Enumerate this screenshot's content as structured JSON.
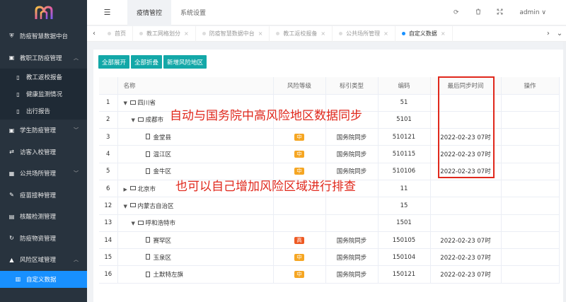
{
  "colors": {
    "sidebar_bg": "#28333e",
    "active": "#1890ff",
    "btn": "#13a8a8",
    "tag_mid": "#f5a623",
    "tag_high": "#ee5a24",
    "annotation": "#e0281c"
  },
  "sidebar": {
    "items": [
      {
        "label": "防疫智慧数据中台",
        "icon": "shield-icon"
      },
      {
        "label": "教职工防疫管理",
        "icon": "briefcase-icon",
        "arrow": "^"
      },
      {
        "label": "教工返校报备",
        "icon": "document-icon",
        "sub": true
      },
      {
        "label": "健康监测情况",
        "icon": "document-icon",
        "sub": true
      },
      {
        "label": "出行报告",
        "icon": "document-icon",
        "sub": true
      },
      {
        "label": "学生防疫管理",
        "icon": "briefcase-icon",
        "arrow": "v"
      },
      {
        "label": "访客入校管理",
        "icon": "swap-icon"
      },
      {
        "label": "公共场所管理",
        "icon": "building-icon",
        "arrow": "v"
      },
      {
        "label": "疫苗接种管理",
        "icon": "syringe-icon"
      },
      {
        "label": "核酸检测管理",
        "icon": "clipboard-icon"
      },
      {
        "label": "防疫物资管理",
        "icon": "refresh-icon"
      },
      {
        "label": "风险区域管理",
        "icon": "warning-icon",
        "arrow": "^"
      },
      {
        "label": "自定义数据",
        "icon": "chart-icon",
        "sub": true,
        "active": true
      }
    ]
  },
  "header": {
    "tabs": [
      "疫情管控",
      "系统设置"
    ],
    "user": "admin",
    "user_arrow": "∨"
  },
  "tabsbar": {
    "tabs": [
      "首页",
      "教工网格划分",
      "防疫智慧数据中台",
      "教工返校报备",
      "公共场所管理",
      "自定义数据"
    ]
  },
  "toolbar": {
    "expand": "全部展开",
    "collapse": "全部折叠",
    "add": "新增风险地区"
  },
  "table": {
    "headers": [
      "",
      "名称",
      "风险等级",
      "标引类型",
      "编码",
      "最后同步时间",
      "操作"
    ],
    "rows": [
      {
        "idx": "1",
        "name": "四川省",
        "level": 0,
        "type": "folder",
        "expanded": true,
        "risk": "",
        "sync": "",
        "code": "51",
        "time": ""
      },
      {
        "idx": "2",
        "name": "成都市",
        "level": 1,
        "type": "folder",
        "expanded": true,
        "risk": "",
        "sync": "",
        "code": "5101",
        "time": ""
      },
      {
        "idx": "3",
        "name": "金堂县",
        "level": 2,
        "type": "file",
        "risk": "中",
        "sync": "国务院同步",
        "code": "510121",
        "time": "2022-02-23 07时"
      },
      {
        "idx": "4",
        "name": "温江区",
        "level": 2,
        "type": "file",
        "risk": "中",
        "sync": "国务院同步",
        "code": "510115",
        "time": "2022-02-23 07时"
      },
      {
        "idx": "5",
        "name": "金牛区",
        "level": 2,
        "type": "file",
        "risk": "中",
        "sync": "国务院同步",
        "code": "510106",
        "time": "2022-02-23 07时"
      },
      {
        "idx": "6",
        "name": "北京市",
        "level": 0,
        "type": "folder",
        "expanded": false,
        "risk": "",
        "sync": "",
        "code": "11",
        "time": ""
      },
      {
        "idx": "12",
        "name": "内蒙古自治区",
        "level": 0,
        "type": "folder",
        "expanded": true,
        "risk": "",
        "sync": "",
        "code": "15",
        "time": ""
      },
      {
        "idx": "13",
        "name": "呼和浩特市",
        "level": 1,
        "type": "folder",
        "expanded": true,
        "risk": "",
        "sync": "",
        "code": "1501",
        "time": ""
      },
      {
        "idx": "14",
        "name": "赛罕区",
        "level": 2,
        "type": "file",
        "risk": "高",
        "sync": "国务院同步",
        "code": "150105",
        "time": "2022-02-23 07时"
      },
      {
        "idx": "15",
        "name": "玉泉区",
        "level": 2,
        "type": "file",
        "risk": "中",
        "sync": "国务院同步",
        "code": "150104",
        "time": "2022-02-23 07时"
      },
      {
        "idx": "16",
        "name": "土默特左旗",
        "level": 2,
        "type": "file",
        "risk": "中",
        "sync": "国务院同步",
        "code": "150121",
        "time": "2022-02-23 07时"
      }
    ]
  },
  "annotations": {
    "a1": "自动与国务院中高风险地区数据同步",
    "a2": "也可以自己增加风险区域进行排查"
  }
}
